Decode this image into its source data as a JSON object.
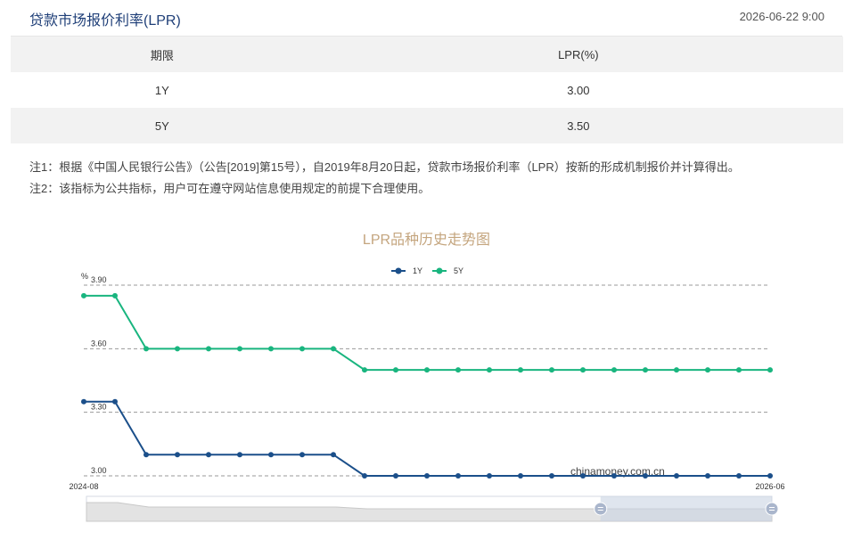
{
  "header": {
    "title": "贷款市场报价利率(LPR)",
    "timestamp": "2026-06-22 9:00"
  },
  "table": {
    "columns": [
      "期限",
      "LPR(%)"
    ],
    "rows": [
      {
        "term": "1Y",
        "rate": "3.00"
      },
      {
        "term": "5Y",
        "rate": "3.50"
      }
    ]
  },
  "notes": [
    "注1：根据《中国人民银行公告》（公告[2019]第15号），自2019年8月20日起，贷款市场报价利率（LPR）按新的形成机制报价并计算得出。",
    "注2：该指标为公共指标，用户可在遵守网站信息使用规定的前提下合理使用。"
  ],
  "chart_data": {
    "type": "line",
    "title": "LPR品种历史走势图",
    "ylabel": "%",
    "ylim": [
      3.0,
      3.9
    ],
    "yticks": [
      "3.00",
      "3.30",
      "3.60",
      "3.90"
    ],
    "x_tick_labels": [
      "2024-08",
      "2026-06"
    ],
    "grid": true,
    "legend_position": "top",
    "watermark": "chinamoney.com.cn",
    "series": [
      {
        "name": "1Y",
        "color": "#1b4f8a",
        "values": [
          3.35,
          3.35,
          3.1,
          3.1,
          3.1,
          3.1,
          3.1,
          3.1,
          3.1,
          3.0,
          3.0,
          3.0,
          3.0,
          3.0,
          3.0,
          3.0,
          3.0,
          3.0,
          3.0,
          3.0,
          3.0,
          3.0,
          3.0
        ]
      },
      {
        "name": "5Y",
        "color": "#19b57f",
        "values": [
          3.85,
          3.85,
          3.6,
          3.6,
          3.6,
          3.6,
          3.6,
          3.6,
          3.6,
          3.5,
          3.5,
          3.5,
          3.5,
          3.5,
          3.5,
          3.5,
          3.5,
          3.5,
          3.5,
          3.5,
          3.5,
          3.5,
          3.5
        ]
      }
    ],
    "datazoom": {
      "start": 0.75,
      "end": 1.0
    }
  }
}
